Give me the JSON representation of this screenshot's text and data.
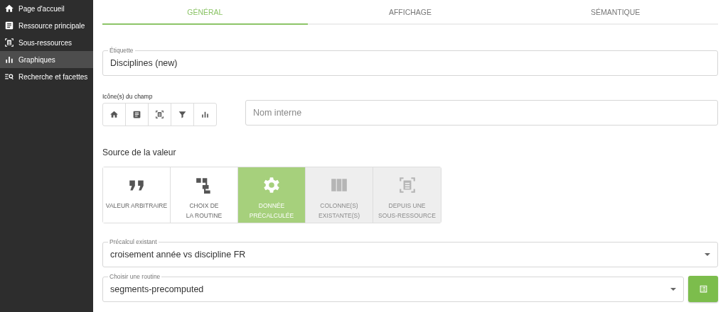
{
  "sidebar": {
    "items": [
      {
        "label": "Page d'accueil",
        "kind": "home",
        "selected": false
      },
      {
        "label": "Ressource principale",
        "kind": "doc",
        "selected": false
      },
      {
        "label": "Sous-ressources",
        "kind": "subres",
        "selected": false
      },
      {
        "label": "Graphiques",
        "kind": "chart",
        "selected": true
      },
      {
        "label": "Recherche et facettes",
        "kind": "searchlist",
        "selected": false
      }
    ]
  },
  "tabs": [
    {
      "label": "GÉNÉRAL",
      "selected": true
    },
    {
      "label": "AFFICHAGE",
      "selected": false
    },
    {
      "label": "SÉMANTIQUE",
      "selected": false
    }
  ],
  "label_field": {
    "label": "Étiquette",
    "value": "Disciplines (new)"
  },
  "field_icons": {
    "label": "Icône(s) du champ",
    "icons": [
      {
        "kind": "home"
      },
      {
        "kind": "doc"
      },
      {
        "kind": "subres"
      },
      {
        "kind": "filter"
      },
      {
        "kind": "chart"
      }
    ]
  },
  "internal_name": {
    "placeholder": "Nom interne"
  },
  "value_source": {
    "title": "Source de la valeur",
    "options": [
      {
        "label": "VALEUR ARBITRAIRE",
        "kind": "quote",
        "selected": false,
        "disabled": false
      },
      {
        "label": "CHOIX DE LA ROUTINE",
        "kind": "tree",
        "selected": false,
        "disabled": false
      },
      {
        "label": "DONNÉE PRÉCALCULÉE",
        "kind": "gear",
        "selected": true,
        "disabled": false
      },
      {
        "label": "COLONNE(S) EXISTANTE(S)",
        "kind": "columns",
        "selected": false,
        "disabled": true
      },
      {
        "label": "DEPUIS UNE SOUS-RESSOURCE",
        "kind": "subres",
        "selected": false,
        "disabled": true
      }
    ]
  },
  "precalc_select": {
    "label": "Précalcul existant",
    "value": "croisement année vs discipline FR"
  },
  "routine_select": {
    "label": "Choisir une routine",
    "value": "segments-precomputed"
  }
}
